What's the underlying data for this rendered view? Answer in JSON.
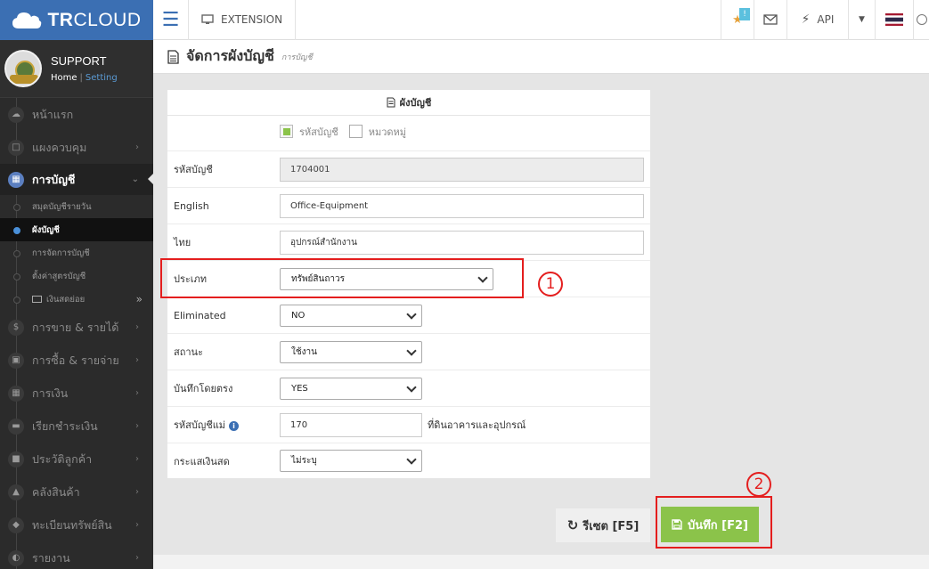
{
  "app": {
    "brand_bold": "TR",
    "brand_rest": "CLOUD"
  },
  "topbar": {
    "extension_label": "EXTENSION",
    "notification_badge": "!",
    "api_label": "API"
  },
  "profile": {
    "name": "SUPPORT",
    "home_link": "Home",
    "separator": "|",
    "setting_link": "Setting"
  },
  "sidebar": {
    "items": [
      {
        "label": "หน้าแรก",
        "icon": "cloud-icon"
      },
      {
        "label": "แผงควบคุม",
        "icon": "monitor-icon"
      },
      {
        "label": "การบัญชี",
        "icon": "book-icon"
      },
      {
        "label": "การขาย & รายได้",
        "icon": "dollar-icon"
      },
      {
        "label": "การซื้อ & รายจ่าย",
        "icon": "cart-icon"
      },
      {
        "label": "การเงิน",
        "icon": "calendar-icon"
      },
      {
        "label": "เรียกชำระเงิน",
        "icon": "card-icon"
      },
      {
        "label": "ประวัติลูกค้า",
        "icon": "contact-icon"
      },
      {
        "label": "คลังสินค้า",
        "icon": "boxes-icon"
      },
      {
        "label": "ทะเบียนทรัพย์สิน",
        "icon": "diamond-icon"
      },
      {
        "label": "รายงาน",
        "icon": "chart-icon"
      }
    ],
    "subitems": [
      {
        "label": "สมุดบัญชีรายวัน"
      },
      {
        "label": "ผังบัญชี"
      },
      {
        "label": "การจัดการบัญชี"
      },
      {
        "label": "ตั้งค่าสูตรบัญชี"
      },
      {
        "label": "เงินสดย่อย"
      }
    ]
  },
  "page": {
    "title": "จัดการผังบัญชี",
    "subtitle": "การบัญชี"
  },
  "form": {
    "heading": "ผังบัญชี",
    "check_account_code": "รหัสบัญชี",
    "check_category": "หมวดหมู่",
    "fields": {
      "code_label": "รหัสบัญชี",
      "code_value": "1704001",
      "english_label": "English",
      "english_value": "Office-Equipment",
      "thai_label": "ไทย",
      "thai_value": "อุปกรณ์สำนักงาน",
      "type_label": "ประเภท",
      "type_value": "ทรัพย์สินถาวร",
      "eliminated_label": "Eliminated",
      "eliminated_value": "NO",
      "status_label": "สถานะ",
      "status_value": "ใช้งาน",
      "direct_label": "บันทึกโดยตรง",
      "direct_value": "YES",
      "parent_label": "รหัสบัญชีแม่",
      "parent_value": "170",
      "parent_desc": "ที่ดินอาคารและอุปกรณ์",
      "cashflow_label": "กระแสเงินสด",
      "cashflow_value": "ไม่ระบุ"
    }
  },
  "annotations": {
    "one": "1",
    "two": "2"
  },
  "buttons": {
    "reset": "รีเซต [F5]",
    "save": "บันทึก [F2]"
  },
  "colors": {
    "brand_blue": "#3b6fb3",
    "save_green": "#8bc34a",
    "annotation_red": "#e41e1e",
    "sidebar_bg": "#2b2b2b"
  }
}
